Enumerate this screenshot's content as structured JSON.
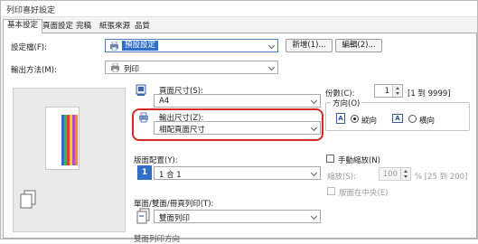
{
  "window": {
    "title": "列印喜好設定"
  },
  "tabs": [
    {
      "label": "基本設定",
      "active": true
    },
    {
      "label": "頁面設定",
      "active": false
    },
    {
      "label": "完稿",
      "active": false
    },
    {
      "label": "紙張來源",
      "active": false
    },
    {
      "label": "品質",
      "active": false
    }
  ],
  "profile": {
    "label": "設定檔(F):",
    "value": "預設設定",
    "new_button": "新增(1)...",
    "edit_button": "編輯(2)..."
  },
  "output": {
    "label": "輸出方法(M):",
    "value": "列印"
  },
  "page_size": {
    "label": "頁面尺寸(S):",
    "value": "A4"
  },
  "output_size": {
    "label": "輸出尺寸(Z):",
    "value": "相配頁面尺寸"
  },
  "copies": {
    "label": "份數(C):",
    "value": "1",
    "range": "[1 到 9999]"
  },
  "orientation": {
    "label": "方向(O)",
    "portrait": "縱向",
    "landscape": "橫向",
    "portrait_icon_text": "A",
    "landscape_icon_text": "A"
  },
  "page_layout": {
    "label": "版面配置(Y):",
    "value": "1 合 1",
    "icon_text": "1"
  },
  "manual_scaling": {
    "label": "手動縮放(N)",
    "scaling_label": "縮放(S):",
    "scaling_value": "100",
    "scaling_range": "% [25 到 200]",
    "center_label": "版面在中央(E)"
  },
  "duplex": {
    "label": "單面/雙面/冊頁列印(T):",
    "value": "雙面列印"
  },
  "bottom": {
    "label": "雙面列印方向"
  },
  "colors": {
    "accent": "#2f6fc9",
    "highlight": "#d62828"
  }
}
